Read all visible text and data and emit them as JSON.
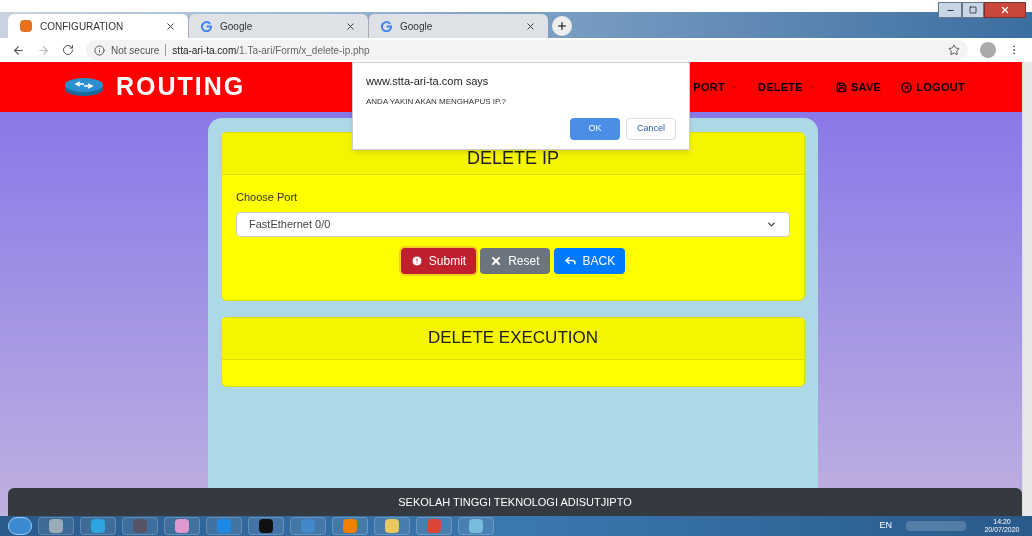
{
  "browser": {
    "tabs": [
      {
        "title": "CONFIGURATION",
        "selected": true,
        "kind": "app"
      },
      {
        "title": "Google",
        "selected": false,
        "kind": "google"
      },
      {
        "title": "Google",
        "selected": false,
        "kind": "google"
      }
    ],
    "security": "Not secure",
    "url_host": "stta-ari-ta.com",
    "url_path": "/1.Ta-ari/Form/x_delete-ip.php"
  },
  "navbar": {
    "brand": "ROUTING",
    "items": [
      {
        "label": "PORT",
        "kind": "dropdown"
      },
      {
        "label": "DELETE",
        "kind": "dropdown"
      },
      {
        "label": "SAVE",
        "kind": "save"
      },
      {
        "label": "LOGOUT",
        "kind": "logout"
      }
    ]
  },
  "dialog": {
    "title": "www.stta-ari-ta.com says",
    "message": "ANDA YAKIN AKAN MENGHAPUS IP.?",
    "ok": "OK",
    "cancel": "Cancel"
  },
  "form_card": {
    "title": "DELETE IP",
    "field_label": "Choose Port",
    "select_value": "FastEthernet 0/0",
    "buttons": [
      {
        "label": "Submit",
        "kind": "danger"
      },
      {
        "label": "Reset",
        "kind": "secondary"
      },
      {
        "label": "BACK",
        "kind": "primary"
      }
    ]
  },
  "execution_card": {
    "title": "DELETE EXECUTION"
  },
  "footer": "SEKOLAH TINGGI TEKNOLOGI ADISUTJIPTO",
  "taskbar": {
    "language": "EN",
    "time": "14:20",
    "date": "20/07/2020"
  }
}
